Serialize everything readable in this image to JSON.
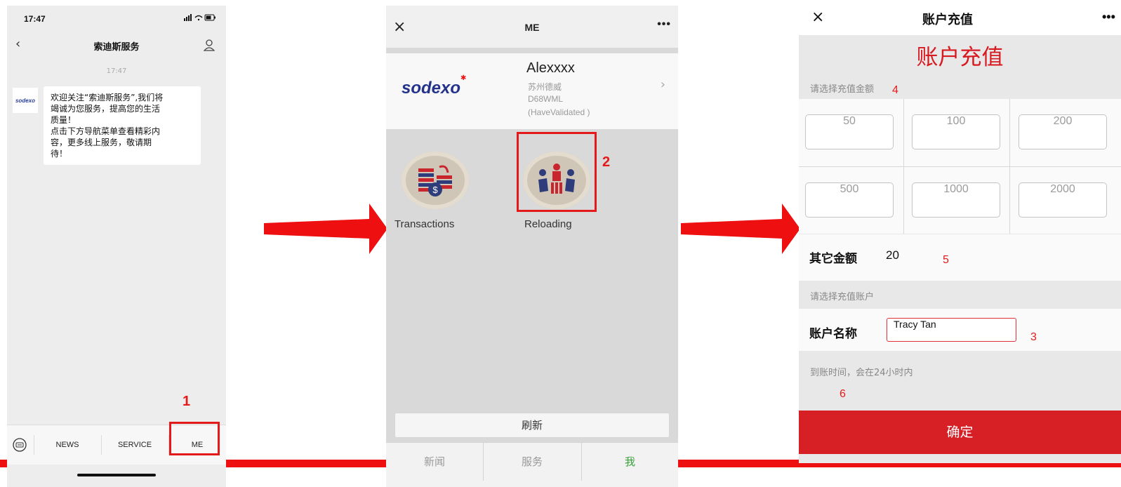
{
  "screen1": {
    "status_time": "17:47",
    "nav_title": "索迪斯服务",
    "timestamp": "17:47",
    "logo_text": "sodexo",
    "message_lines": [
      "欢迎关注“索迪斯服务”,我们将",
      "竭诚为您服务，提高您的生活",
      "质量！",
      "点击下方导航菜单查看精彩内",
      "容，更多线上服务，敬请期",
      "待！"
    ],
    "menu": [
      "NEWS",
      "SERVICE",
      "ME"
    ],
    "step_marker": "1"
  },
  "screen2": {
    "title": "ME",
    "dots": "•••",
    "close": "×",
    "logo_text": "sodexo",
    "user": {
      "name": "Alexxxx",
      "line1": "苏州德威",
      "line2": "D68WML",
      "line3": "(HaveValidated )"
    },
    "features": [
      "Transactions",
      "Reloading"
    ],
    "refresh_label": "刷新",
    "tabs": [
      "新闻",
      "服务",
      "我"
    ],
    "active_tab_color": "#3aa03a",
    "step_marker": "2"
  },
  "screen3": {
    "title": "账户充值",
    "close": "×",
    "dots": "•••",
    "heading": "账户充值",
    "select_amount_label": "请选择充值金额",
    "amounts": [
      "50",
      "100",
      "200",
      "500",
      "1000",
      "2000"
    ],
    "other_amount_label": "其它金额",
    "other_amount_value": "20",
    "select_account_label": "请选择充值账户",
    "account_name_label": "账户名称",
    "account_name_value": "Tracy Tan",
    "arrival_note": "到账时间，会在24小时内",
    "confirm_label": "确定",
    "accent_color": "#d71f26",
    "markers": {
      "amount": "4",
      "other": "5",
      "account": "3",
      "note": "6"
    }
  },
  "colors": {
    "annotation_red": "#e41a1a",
    "arrow_red": "#ee1010"
  }
}
